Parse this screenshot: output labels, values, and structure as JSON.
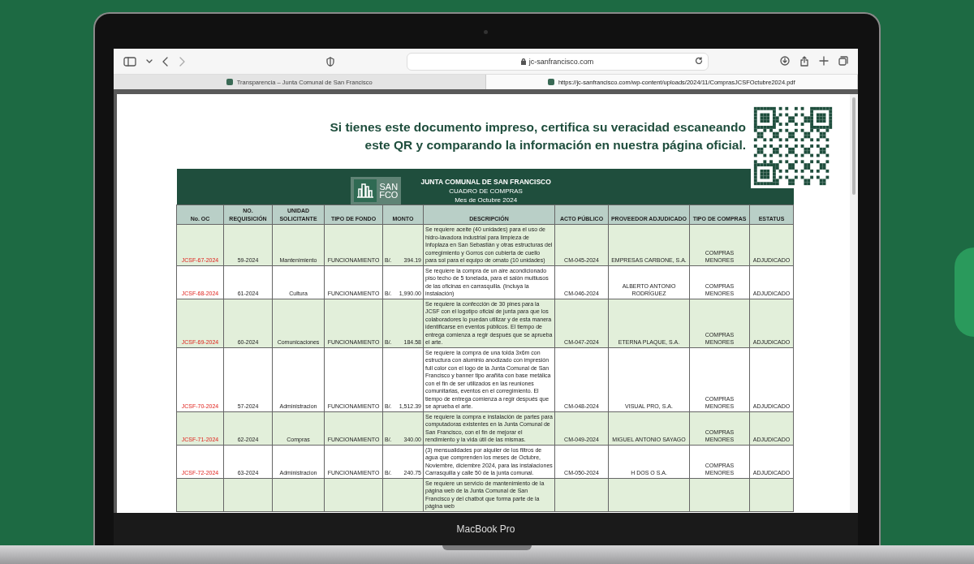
{
  "browser": {
    "address": "jc-sanfrancisco.com",
    "tabs": [
      {
        "title": "Transparencia – Junta Comunal de San Francisco",
        "selected": false
      },
      {
        "title": "https://jc-sanfrancisco.com/wp-content/uploads/2024/11/ComprasJCSFOctubre2024.pdf",
        "selected": true
      }
    ]
  },
  "document": {
    "notice": [
      "Si tienes este documento impreso, certifica su veracidad escaneando",
      "este QR y comparando la información en nuestra página oficial."
    ],
    "logo": {
      "line_1": "SAN",
      "line_2": "FCO"
    },
    "title": "JUNTA COMUNAL DE SAN FRANCISCO",
    "subtitle": "CUADRO DE COMPRAS",
    "period": "Mes de Octubre 2024",
    "table": {
      "columns": [
        "No. OC",
        "NO. REQUISICIÓN",
        "UNIDAD SOLICITANTE",
        "TIPO DE FONDO",
        "MONTO",
        "DESCRIPCIÓN",
        "ACTO PÚBLICO",
        "PROVEEDOR ADJUDICADO",
        "TIPO DE COMPRAS",
        "ESTATUS"
      ],
      "rows": [
        {
          "no_oc": "JCSF-67-2024",
          "requisicion": "59-2024",
          "unidad": "Mantenimiento",
          "fondo": "FUNCIONAMIENTO",
          "currency": "B/.",
          "monto": "394.19",
          "descripcion": "Se requiere aceite (40 unidades) para el uso de hidro-lavadora industrial para limpieza de Infoplaza en San Sebastián y otras estructuras del corregimiento y Gorros con cubierta de cuello para sol para el equipo de ornato (10 unidades)",
          "acto": "CM-045-2024",
          "proveedor": "EMPRESAS CARBONE, S.A.",
          "tipo": "COMPRAS MENORES",
          "estatus": "ADJUDICADO"
        },
        {
          "no_oc": "JCSF-68-2024",
          "requisicion": "61-2024",
          "unidad": "Cultura",
          "fondo": "FUNCIONAMIENTO",
          "currency": "B/.",
          "monto": "1,990.00",
          "descripcion": "Se requiere la compra de un aire acondicionado piso techo de 5 tonelada, para el salón multiusos de las oficinas en carrasquilla. (Incluya la instalación)",
          "acto": "CM-046-2024",
          "proveedor": "ALBERTO ANTONIO RODRÍGUEZ",
          "tipo": "COMPRAS MENORES",
          "estatus": "ADJUDICADO"
        },
        {
          "no_oc": "JCSF-69-2024",
          "requisicion": "60-2024",
          "unidad": "Comunicaciones",
          "fondo": "FUNCIONAMIENTO",
          "currency": "B/.",
          "monto": "184.58",
          "descripcion": "Se requiere la confección de 30 pines para la JCSF con el logotipo oficial de junta para que los colaboradores lo puedan utilizar y de esta manera identificarse en eventos públicos.  El tiempo de entrega comienza a regir después que se aprueba el arte.",
          "acto": "CM-047-2024",
          "proveedor": "ETERNA PLAQUE, S.A.",
          "tipo": "COMPRAS MENORES",
          "estatus": "ADJUDICADO"
        },
        {
          "no_oc": "JCSF-70-2024",
          "requisicion": "57-2024",
          "unidad": "Administracion",
          "fondo": "FUNCIONAMIENTO",
          "currency": "B/.",
          "monto": "1,512.39",
          "descripcion": "Se requiere la compra de una tolda 3x6m con estructura con aluminio anodizado con impresión full color con el logo de la Junta Comunal de San Francisco y banner tipo arañita con base metálica con el fin de ser utilizados en las reuniones comunitarias, eventos en el corregimiento.  El tiempo de entrega comienza a regir después que se aprueba el arte.",
          "acto": "CM-048-2024",
          "proveedor": "VISUAL PRO, S.A.",
          "tipo": "COMPRAS MENORES",
          "estatus": "ADJUDICADO"
        },
        {
          "no_oc": "JCSF-71-2024",
          "requisicion": "62-2024",
          "unidad": "Compras",
          "fondo": "FUNCIONAMIENTO",
          "currency": "B/.",
          "monto": "340.00",
          "descripcion": "Se requiere la compra e instalación de partes para computadoras existentes en la Junta Comunal de San Francisco, con el fin de mejorar el rendimiento y la vida útil de las mismas.",
          "acto": "CM-049-2024",
          "proveedor": "MIGUEL ANTONIO SAYAGO",
          "tipo": "COMPRAS MENORES",
          "estatus": "ADJUDICADO"
        },
        {
          "no_oc": "JCSF-72-2024",
          "requisicion": "63-2024",
          "unidad": "Administracion",
          "fondo": "FUNCIONAMIENTO",
          "currency": "B/.",
          "monto": "240.75",
          "descripcion": "(3) mensualidades por alquiler de los filtros de agua que comprenden los meses de Octubre, Noviembre, diciembre 2024, para las instalaciones Carrasquilla y calle 50 de la junta comunal.",
          "acto": "CM-050-2024",
          "proveedor": "H DOS O S.A.",
          "tipo": "COMPRAS MENORES",
          "estatus": "ADJUDICADO"
        },
        {
          "descripcion": "Se requiere un servicio de mantenimiento de la página web de la Junta Comunal de San Francisco y del chatbot que forma parte de la página web"
        }
      ]
    }
  },
  "device": {
    "label": "MacBook Pro"
  }
}
